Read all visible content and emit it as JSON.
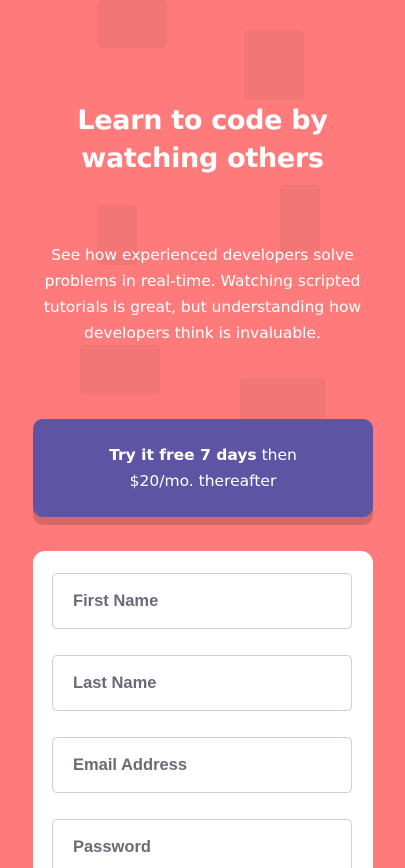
{
  "hero": {
    "title_line1": "Learn to code by",
    "title_line2": "watching others",
    "description": "See how experienced developers solve problems in real-time. Watching scripted tutorials is great, but understanding how developers think is invaluable."
  },
  "promo": {
    "bold_text": "Try it free 7 days",
    "rest_text": " then",
    "line2": "$20/mo. thereafter"
  },
  "form": {
    "first_name_placeholder": "First Name",
    "last_name_placeholder": "Last Name",
    "email_placeholder": "Email Address",
    "password_placeholder": "Password"
  },
  "colors": {
    "background": "#ff7a7a",
    "promo": "#5e54a4",
    "card": "#ffffff"
  }
}
